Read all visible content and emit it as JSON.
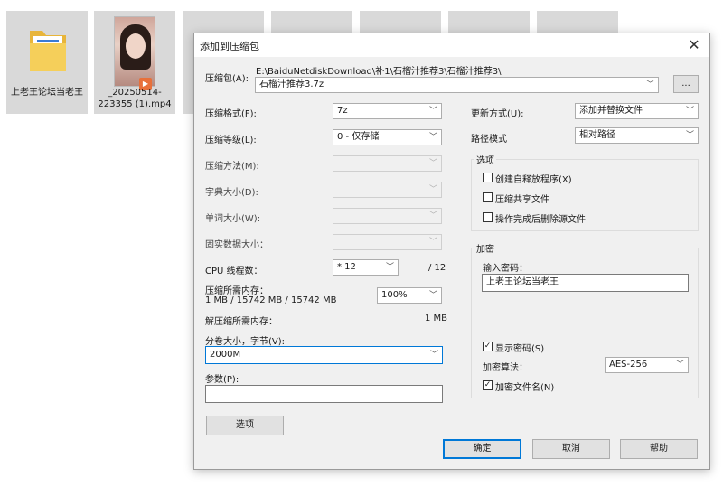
{
  "desktop": {
    "icons": [
      {
        "label": "上老王论坛当老王",
        "icon": "folder-icon"
      },
      {
        "label": "_20250514-223355 (1).mp4",
        "icon": "video-thumbnail"
      }
    ]
  },
  "dialog": {
    "title": "添加到压缩包",
    "archive_label": "压缩包(A):",
    "archive_path": "E:\\BaiduNetdiskDownload\\补1\\石榴汁推荐3\\石榴汁推荐3\\",
    "archive_name": "石榴汁推荐3.7z",
    "browse_label": "...",
    "format_label": "压缩格式(F):",
    "format_value": "7z",
    "level_label": "压缩等级(L):",
    "level_value": "0 - 仅存储",
    "method_label": "压缩方法(M):",
    "dict_label": "字典大小(D):",
    "word_label": "单词大小(W):",
    "solid_label": "固实数据大小：",
    "cpu_label": "CPU 线程数：",
    "cpu_value": "* 12",
    "cpu_total": "/ 12",
    "mem_label": "压缩所需内存：",
    "mem_value": "1 MB / 15742 MB / 15742 MB",
    "mem_percent": "100%",
    "decomp_label": "解压缩所需内存：",
    "decomp_value": "1 MB",
    "split_label": "分卷大小，字节(V):",
    "split_value": "2000M",
    "params_label": "参数(P):",
    "params_value": "",
    "options_button": "选项",
    "update_label": "更新方式(U):",
    "update_value": "添加并替换文件",
    "path_label": "路径模式",
    "path_value": "相对路径",
    "options_group": "选项",
    "opt_sfx": "创建自释放程序(X)",
    "opt_sfx_checked": false,
    "opt_shared": "压缩共享文件",
    "opt_shared_checked": false,
    "opt_delete": "操作完成后删除源文件",
    "opt_delete_checked": false,
    "encrypt_group": "加密",
    "password_label": "输入密码：",
    "password_value": "上老王论坛当老王",
    "show_password": "显示密码(S)",
    "show_password_checked": true,
    "enc_method_label": "加密算法：",
    "enc_method_value": "AES-256",
    "encrypt_names": "加密文件名(N)",
    "encrypt_names_checked": true,
    "ok_button": "确定",
    "cancel_button": "取消",
    "help_button": "帮助"
  }
}
